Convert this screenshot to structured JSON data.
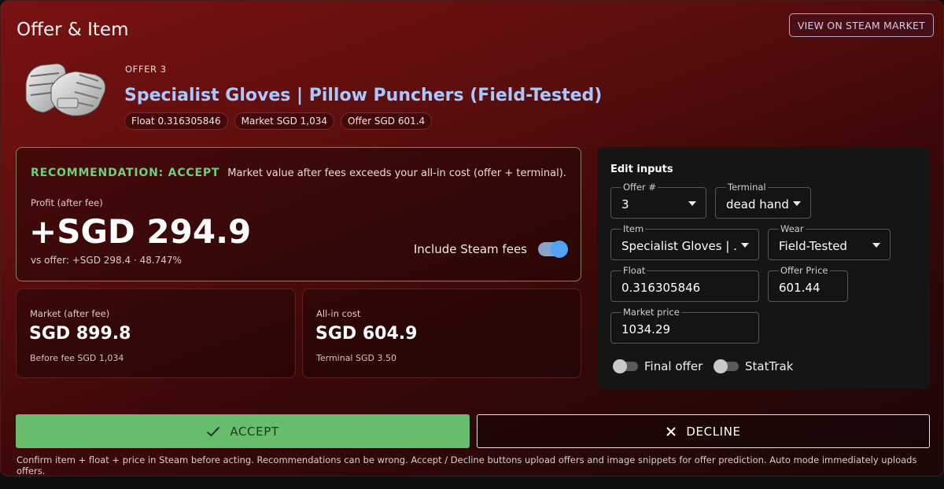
{
  "panel": {
    "title": "Offer & Item",
    "market_button": "VIEW ON STEAM MARKET"
  },
  "item": {
    "offer_label": "OFFER 3",
    "name": "Specialist Gloves | Pillow Punchers (Field-Tested)",
    "pills": {
      "float": "Float 0.316305846",
      "market": "Market SGD 1,034",
      "offer": "Offer SGD 601.4"
    },
    "thumbnail_icon": "gloves-image"
  },
  "recommendation": {
    "tag": "RECOMMENDATION: ACCEPT",
    "description": "Market value after fees exceeds your all-in cost (offer + terminal).",
    "profit_label": "Profit (after fee)",
    "profit_value": "+SGD 294.9",
    "vs_offer": "vs offer: +SGD 298.4 · 48.747%",
    "fees_toggle_label": "Include Steam fees",
    "fees_toggle_on": true
  },
  "stats": {
    "market": {
      "label": "Market (after fee)",
      "value": "SGD 899.8",
      "sub": "Before fee SGD 1,034"
    },
    "allin": {
      "label": "All-in cost",
      "value": "SGD 604.9",
      "sub": "Terminal SGD 3.50"
    }
  },
  "edit": {
    "title": "Edit inputs",
    "offer_num": {
      "label": "Offer #",
      "value": "3"
    },
    "terminal": {
      "label": "Terminal",
      "value": "dead hand"
    },
    "item": {
      "label": "Item",
      "value": "Specialist Gloves | ..."
    },
    "wear": {
      "label": "Wear",
      "value": "Field-Tested"
    },
    "float": {
      "label": "Float",
      "value": "0.316305846"
    },
    "offer_price": {
      "label": "Offer Price",
      "value": "601.44"
    },
    "market_price": {
      "label": "Market price",
      "value": "1034.29"
    },
    "final_offer": {
      "label": "Final offer",
      "on": false
    },
    "stattrak": {
      "label": "StatTrak",
      "on": false
    }
  },
  "actions": {
    "accept": "ACCEPT",
    "decline": "DECLINE"
  },
  "disclaimer": "Confirm item + float + price in Steam before acting. Recommendations can be wrong. Accept / Decline buttons upload offers and image snippets for offer prediction. Auto mode immediately uploads offers.",
  "colors": {
    "accent_accept": "#67bd6c",
    "item_name": "#a9c8ff",
    "recommendation": "#6fd07a",
    "toggle_on": "#4fa3f0"
  }
}
